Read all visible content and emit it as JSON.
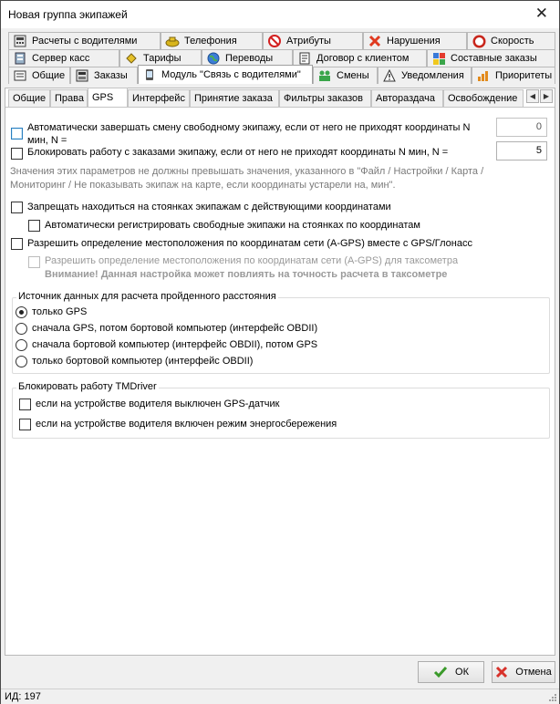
{
  "window": {
    "title": "Новая группа экипажей",
    "close_glyph": "✕"
  },
  "tab_rows": {
    "row1": [
      {
        "label": "Расчеты с водителями",
        "icon": "calculator-icon"
      },
      {
        "label": "Телефония",
        "icon": "phone-icon"
      },
      {
        "label": "Атрибуты",
        "icon": "no-smoking-icon"
      },
      {
        "label": "Нарушения",
        "icon": "red-x-icon"
      },
      {
        "label": "Скорость",
        "icon": "speed-limit-icon"
      }
    ],
    "row2": [
      {
        "label": "Сервер касс",
        "icon": "cash-server-icon"
      },
      {
        "label": "Тарифы",
        "icon": "tariff-icon"
      },
      {
        "label": "Переводы",
        "icon": "globe-icon"
      },
      {
        "label": "Договор с клиентом",
        "icon": "contract-icon"
      },
      {
        "label": "Составные заказы",
        "icon": "puzzle-icon"
      }
    ],
    "row3": [
      {
        "label": "Общие",
        "icon": "general-icon"
      },
      {
        "label": "Заказы",
        "icon": "orders-icon"
      },
      {
        "label": "Модуль \"Связь с водителями\"",
        "icon": "driver-module-icon"
      },
      {
        "label": "Смены",
        "icon": "people-icon"
      },
      {
        "label": "Уведомления",
        "icon": "warning-icon"
      },
      {
        "label": "Приоритеты",
        "icon": "priority-icon"
      }
    ]
  },
  "subtabs": [
    "Общие",
    "Права",
    "GPS",
    "Интерфейс",
    "Принятие заказа",
    "Фильтры заказов",
    "Автораздача",
    "Освобождение"
  ],
  "scroll": {
    "left": "◀",
    "right": "▶"
  },
  "gps": {
    "auto_end_shift": {
      "line1": "Автоматически завершать смену свободному экипажу, если от него не приходят координаты N",
      "line2": "мин, N =",
      "value": "0",
      "checked": false
    },
    "block_orders": {
      "label": "Блокировать работу с заказами экипажу, если от него не приходят координаты N мин, N =",
      "value": "5",
      "checked": false
    },
    "hint_line1": "Значения этих параметров не должны превышать значения, указанного в \"Файл / Настройки / Карта /",
    "hint_line2": "Мониторинг / Не показывать экипаж на карте, если координаты устарели на, мин\".",
    "forbid_parking": "Запрещать находиться на стоянках экипажам с действующими координатами",
    "auto_register": "Автоматически регистрировать свободные экипажи на стоянках по координатам",
    "allow_agps": "Разрешить определение местоположения по координатам сети (A-GPS) вместе с GPS/Глонасс",
    "allow_agps_taximeter": "Разрешить определение местоположения по координатам сети (A-GPS) для таксометра",
    "warning": "Внимание! Данная настройка может повлиять на точность расчета в таксометре"
  },
  "distance_source": {
    "title": "Источник данных для расчета пройденного расстояния",
    "options": [
      "только GPS",
      "сначала GPS, потом бортовой компьютер (интерфейс OBDII)",
      "сначала бортовой компьютер (интерфейс OBDII), потом GPS",
      "только бортовой компьютер (интерфейс OBDII)"
    ],
    "selected": 0
  },
  "tmdriver": {
    "title": "Блокировать работу TMDriver",
    "options": [
      "если на устройстве водителя выключен GPS-датчик",
      "если на устройстве водителя включен режим энергосбережения"
    ]
  },
  "buttons": {
    "ok": "ОК",
    "cancel": "Отмена"
  },
  "status": {
    "id_text": "ИД: 197"
  },
  "colors": {
    "accent": "#2a7fbf",
    "ok_green": "#3a9a2a",
    "cancel_red": "#d8322b"
  }
}
